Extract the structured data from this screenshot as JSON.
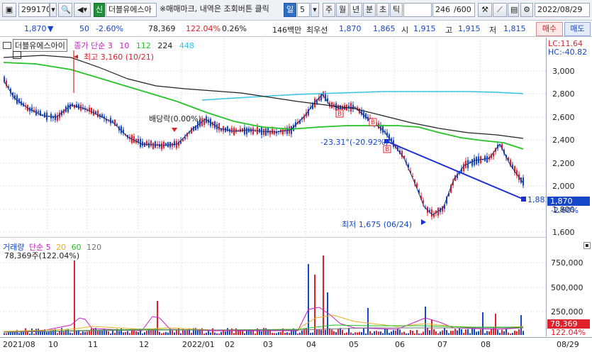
{
  "toolbar": {
    "code": "299170",
    "market_tag": "신",
    "name": "더블유에스아",
    "hint": "※매매마크, 내역은 조회버튼 클릭",
    "periods": [
      "일",
      "5",
      "주",
      "월",
      "년",
      "분",
      "초",
      "틱"
    ],
    "selected_period": "일",
    "count": "246",
    "total": "/600",
    "date": "2022/08/29"
  },
  "info": {
    "price": "1,870",
    "change_arrow": "▼",
    "change": "50",
    "rate": "-2.60%",
    "volume": "78,369",
    "vol_ratio": "122.04%",
    "turnover": "0.26%",
    "amount_label": "146백만",
    "best_ask_label": "최우선",
    "best_ask": "1,870",
    "best_bid": "1,865",
    "open_label": "시",
    "open": "1,915",
    "high_label": "고",
    "high": "1,915",
    "low_label": "저",
    "low": "1,815",
    "buy_btn": "매수",
    "sell_btn": "매도"
  },
  "price_legend": {
    "name": "더블유에스아이",
    "indicator": "종가 단순 3",
    "ma10": "10",
    "ma112": "112",
    "ma224": "224",
    "ma448": "448",
    "lc": "LC:11.64",
    "hc": "HC:-40.82"
  },
  "annotations": {
    "high": "최고 3,160 (10/21)",
    "low": "최저 1,675 (06/24)",
    "dividend": "배당락(0.00%)",
    "trend": "-23.31°(-20.92%)",
    "end_value": "1,882"
  },
  "price_axis": [
    "3,000",
    "2,800",
    "2,600",
    "2,400",
    "2,200",
    "2,000",
    "1,800",
    "1,600"
  ],
  "price_current": {
    "price": "1,870",
    "rate": "-2.60%"
  },
  "volume_legend": {
    "title": "거래량",
    "ma": "단순 5",
    "ma20": "20",
    "ma60": "60",
    "ma120": "120",
    "current": "78,369주(122.04%)"
  },
  "volume_axis": [
    "750,000",
    "500,000",
    "250,000"
  ],
  "volume_current": {
    "vol": "78,369",
    "ratio": "122.04%"
  },
  "x_axis": [
    "2021/08",
    "10",
    "11",
    "12",
    "2022/01",
    "02",
    "03",
    "04",
    "05",
    "06",
    "07",
    "08",
    "08/29"
  ],
  "colors": {
    "up": "#e0202a",
    "down": "#1747c9",
    "ma3": "#1c2f7a",
    "ma112": "#26c326",
    "ma224": "#222222",
    "ma448": "#34c3e6",
    "ma10": "#c81ec8"
  }
}
